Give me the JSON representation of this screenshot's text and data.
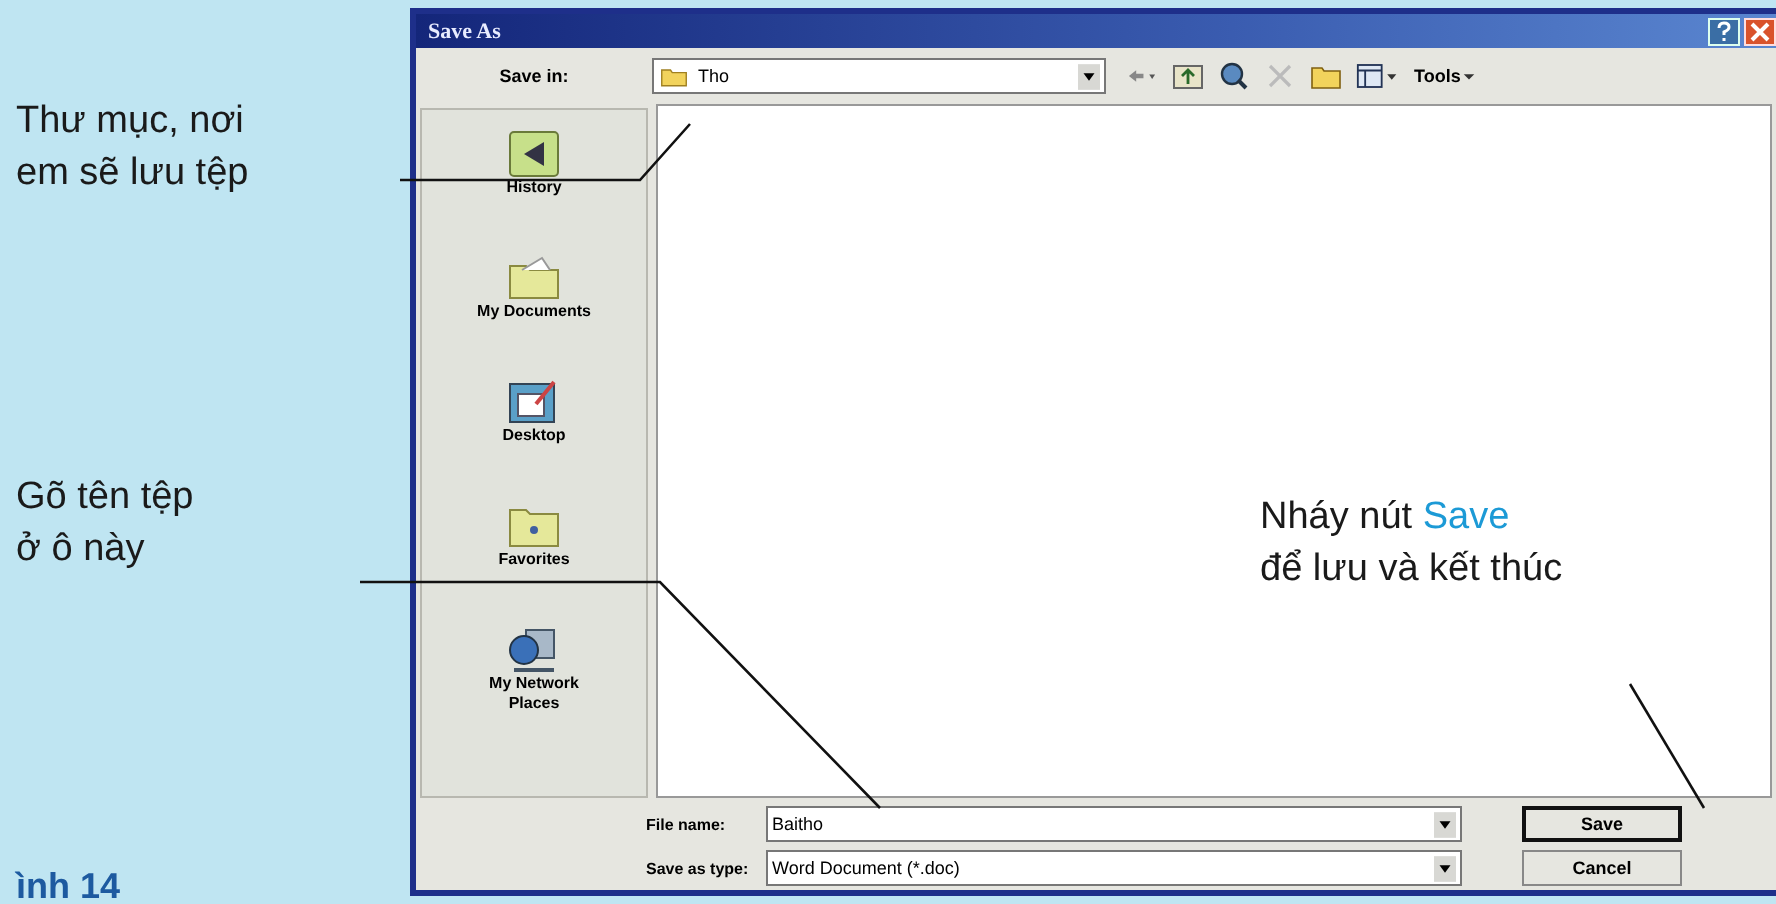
{
  "window": {
    "title": "Save As"
  },
  "toolbar": {
    "save_in_label": "Save in:",
    "save_in_value": "Tho",
    "tools_label": "Tools"
  },
  "places": [
    {
      "label": "History",
      "kind": "history"
    },
    {
      "label": "My Documents",
      "kind": "documents"
    },
    {
      "label": "Desktop",
      "kind": "desktop"
    },
    {
      "label": "Favorites",
      "kind": "favorites"
    },
    {
      "label": "My Network Places",
      "kind": "network"
    }
  ],
  "file_name": {
    "label": "File name:",
    "value": "Baitho"
  },
  "save_as_type": {
    "label": "Save as type:",
    "value": "Word Document (*.doc)"
  },
  "buttons": [
    {
      "label": "Save",
      "default": true
    },
    {
      "label": "Cancel",
      "default": false
    }
  ],
  "callouts": {
    "folder": [
      "Thư mục, nơi",
      "em sẽ lưu tệp"
    ],
    "file_name": [
      "Gõ tên tệp",
      "ở ô này"
    ],
    "save": {
      "parts": [
        {
          "text": "Nháy nút ",
          "highlight": false
        },
        {
          "text": "Save",
          "highlight": true
        }
      ],
      "line2": "để lưu và kết thúc"
    }
  },
  "caption": "ình 14"
}
